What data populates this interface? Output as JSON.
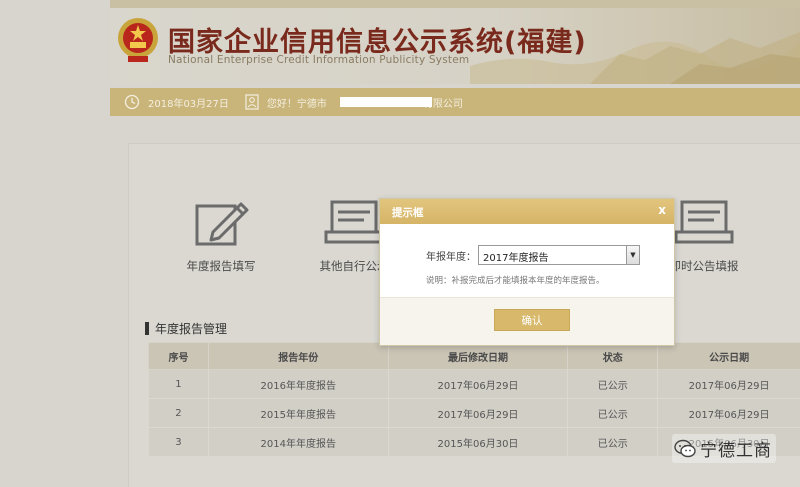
{
  "header": {
    "title_cn": "国家企业信用信息公示系统(福建)",
    "title_en": "National Enterprise Credit Information Publicity System",
    "emblem_icon": "national-emblem-icon"
  },
  "infobar": {
    "date": "2018年03月27日",
    "welcome": "您好！宁德市",
    "welcome_suffix": "有限公司"
  },
  "features": [
    {
      "label": "年度报告填写",
      "icon": "edit-report-icon"
    },
    {
      "label": "其他自行公示",
      "icon": "other-publicity-icon"
    },
    {
      "label": "即时公告填报",
      "icon": "instant-announcement-icon"
    }
  ],
  "section": {
    "title": "年度报告管理"
  },
  "table": {
    "headers": [
      "序号",
      "报告年份",
      "最后修改日期",
      "状态",
      "公示日期"
    ],
    "rows": [
      [
        "1",
        "2016年年度报告",
        "2017年06月29日",
        "已公示",
        "2017年06月29日"
      ],
      [
        "2",
        "2015年年度报告",
        "2017年06月29日",
        "已公示",
        "2017年06月29日"
      ],
      [
        "3",
        "2014年年度报告",
        "2015年06月30日",
        "已公示",
        "2015年06月30日"
      ]
    ]
  },
  "modal": {
    "title": "提示框",
    "close": "x",
    "year_label": "年报年度：",
    "year_value": "2017年度报告",
    "note": "说明：补报完成后才能填报本年度的年度报告。",
    "confirm": "确认"
  },
  "watermark": {
    "text": "宁德工商"
  },
  "colors": {
    "title_red": "#7a2a1c",
    "gold_bar": "#c9b57a",
    "modal_header": "#d5b466",
    "confirm_button": "#d8b96b"
  }
}
